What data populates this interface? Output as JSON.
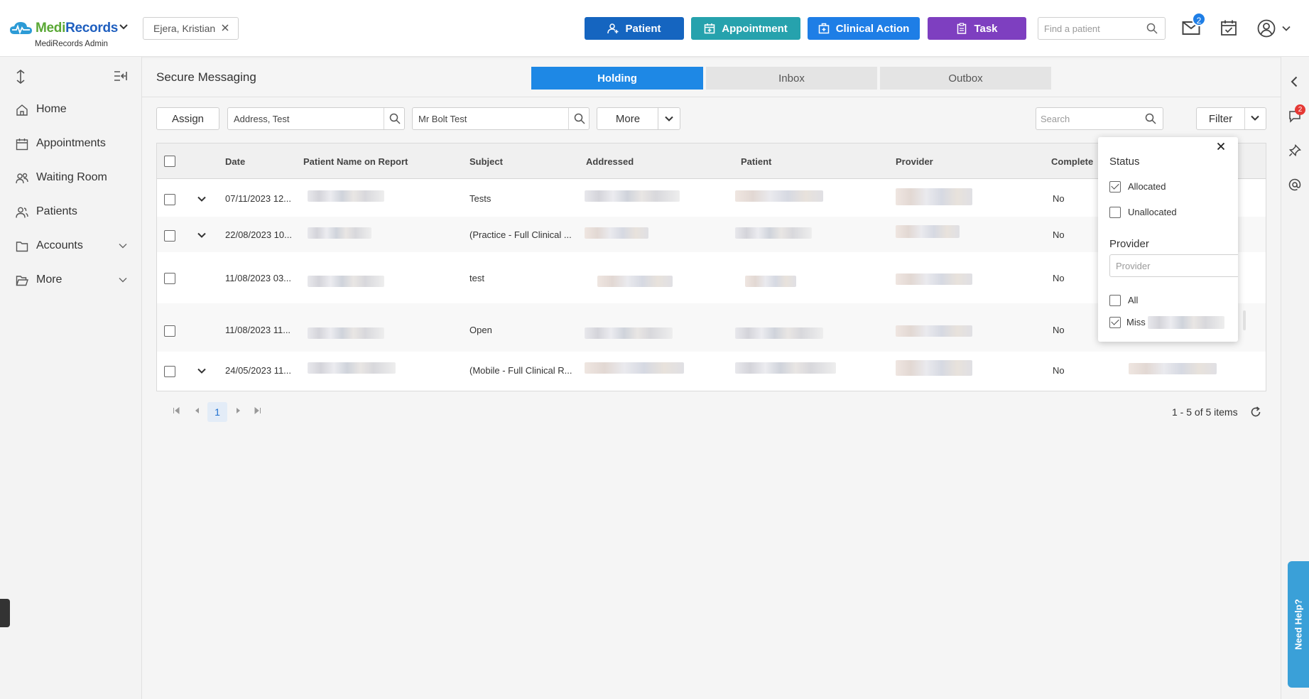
{
  "app": {
    "brand_medi": "Medi",
    "brand_records": "Records",
    "subtitle": "MediRecords Admin",
    "current_patient": "Ejera, Kristian",
    "colors": {
      "primary": "#1e88e5",
      "patient": "#1565c0",
      "appointment": "#26a2ad",
      "clinical": "#1e7ee6",
      "task": "#7e3fc0"
    }
  },
  "topbar": {
    "buttons": [
      {
        "label": "Patient",
        "icon": "person-add-icon"
      },
      {
        "label": "Appointment",
        "icon": "calendar-plus-icon"
      },
      {
        "label": "Clinical Action",
        "icon": "medical-bag-icon"
      },
      {
        "label": "Task",
        "icon": "clipboard-icon"
      }
    ],
    "find_placeholder": "Find a patient",
    "mail_badge": "2"
  },
  "sidebar": {
    "items": [
      {
        "label": "Home",
        "icon": "home-icon"
      },
      {
        "label": "Appointments",
        "icon": "calendar-icon"
      },
      {
        "label": "Waiting Room",
        "icon": "group-icon"
      },
      {
        "label": "Patients",
        "icon": "people-icon"
      },
      {
        "label": "Accounts",
        "icon": "folder-icon"
      },
      {
        "label": "More",
        "icon": "folder-open-icon"
      }
    ]
  },
  "main": {
    "title": "Secure Messaging",
    "tabs": [
      "Holding",
      "Inbox",
      "Outbox"
    ],
    "active_tab": "Holding",
    "toolbar": {
      "assign": "Assign",
      "address_value": "Address, Test",
      "patient_value": "Mr Bolt Test",
      "more": "More",
      "search_placeholder": "Search",
      "filter": "Filter"
    }
  },
  "table": {
    "columns": [
      "Date",
      "Patient Name on Report",
      "Subject",
      "Addressed",
      "Patient",
      "Provider",
      "Complete"
    ],
    "rows": [
      {
        "date": "07/11/2023 12...",
        "subject": "Tests",
        "complete": "No"
      },
      {
        "date": "22/08/2023 10...",
        "subject": "(Practice - Full Clinical ...",
        "complete": "No"
      },
      {
        "date": "11/08/2023 03...",
        "subject": "test",
        "complete": "No"
      },
      {
        "date": "11/08/2023 11...",
        "subject": "Open",
        "complete": "No"
      },
      {
        "date": "24/05/2023 11...",
        "subject": "(Mobile - Full Clinical R...",
        "complete": "No"
      }
    ],
    "current_page": "1",
    "items_count": "1 - 5 of 5 items"
  },
  "filter_popup": {
    "status_heading": "Status",
    "allocated": "Allocated",
    "unallocated": "Unallocated",
    "provider_heading": "Provider",
    "provider_placeholder": "Provider",
    "all": "All",
    "miss": "Miss"
  },
  "rail": {
    "chat_badge": "2",
    "need_help": "Need Help?"
  }
}
